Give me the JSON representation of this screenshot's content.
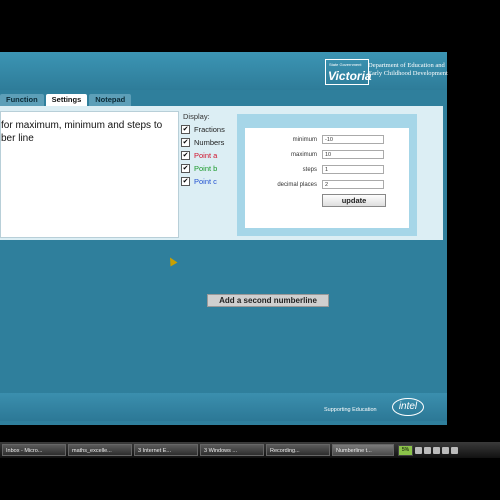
{
  "header": {
    "logo_small": "State Government",
    "logo_big": "Victoria",
    "department_line1": "Department of Education and",
    "department_line2": "Early Childhood Development"
  },
  "tabs": [
    {
      "label": "Function",
      "active": false
    },
    {
      "label": "Settings",
      "active": true
    },
    {
      "label": "Notepad",
      "active": false
    }
  ],
  "instructions": "for maximum, minimum and steps to\nber line",
  "display": {
    "title": "Display:",
    "options": [
      {
        "label": "Fractions",
        "checked": true,
        "color": "#222222"
      },
      {
        "label": "Numbers",
        "checked": true,
        "color": "#222222"
      },
      {
        "label": "Point a",
        "checked": true,
        "color": "#d0102a"
      },
      {
        "label": "Point b",
        "checked": true,
        "color": "#1a9a2a"
      },
      {
        "label": "Point c",
        "checked": true,
        "color": "#2050d0"
      }
    ]
  },
  "settings": {
    "fields": [
      {
        "label": "minimum",
        "value": "-10"
      },
      {
        "label": "maximum",
        "value": "10"
      },
      {
        "label": "steps",
        "value": "1"
      },
      {
        "label": "decimal places",
        "value": "2"
      }
    ],
    "update_label": "update"
  },
  "add_numberline_label": "Add a second numberline",
  "footer": {
    "supporting": "Supporting Education",
    "intel": "intel"
  },
  "taskbar": {
    "items": [
      {
        "label": "Inbox - Micro..."
      },
      {
        "label": "maths_excelle..."
      },
      {
        "label": "3 Internet E..."
      },
      {
        "label": "3 Windows ..."
      },
      {
        "label": "Recording..."
      },
      {
        "label": "Numberline t..."
      }
    ],
    "tray_label": "5%"
  },
  "colors": {
    "app_bg": "#2f7f9c",
    "panel_bg": "#dceef4",
    "settings_bg": "#a6d6e8"
  }
}
